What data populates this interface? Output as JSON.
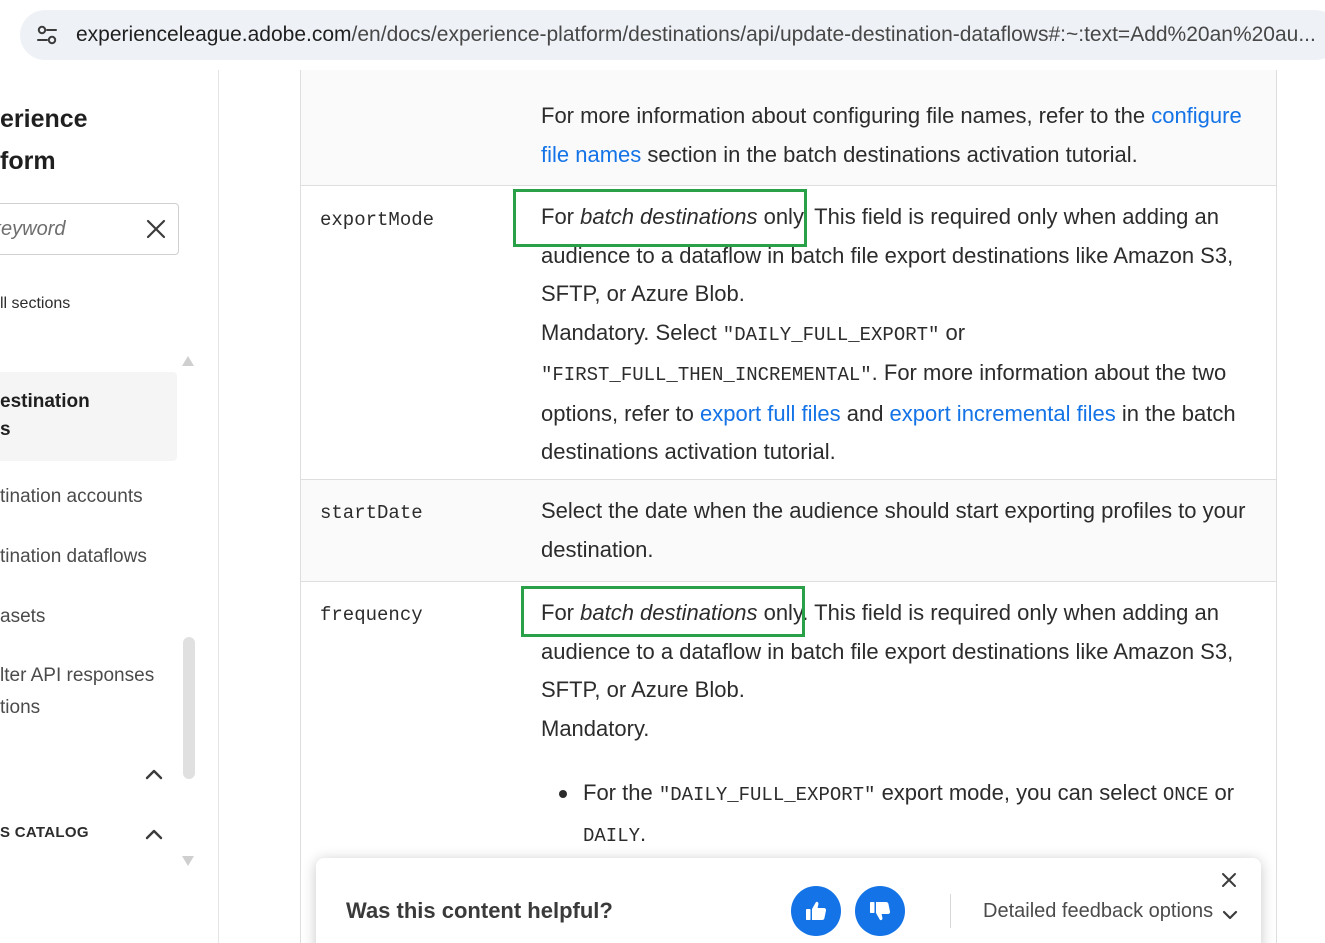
{
  "browser": {
    "url_domain": "experienceleague.adobe.com",
    "url_path": "/en/docs/experience-platform/destinations/api/update-destination-dataflows#:~:text=Add%20an%20au..."
  },
  "sidebar": {
    "title_line1": "erience",
    "title_line2": "form",
    "search_placeholder": "keyword",
    "all_sections": "ll sections",
    "active_item_line1": "estination",
    "active_item_line2": "s",
    "items": [
      "tination accounts",
      "tination dataflows",
      "asets",
      "lter API responses",
      "tions"
    ],
    "catalog_label": "S CATALOG"
  },
  "table": {
    "row0": {
      "desc_text1": "For more information about configuring file names, refer to the ",
      "desc_link": "configure file names",
      "desc_text2": " section in the batch destinations activation tutorial."
    },
    "row1": {
      "param": "exportMode",
      "for": "For ",
      "batch": "batch destinations",
      "only": " only.",
      "text1": " This field is required only when adding an audience to a dataflow in batch file export destinations like Amazon S3, SFTP, or Azure Blob.",
      "mandatory": "Mandatory. Select ",
      "code1": "\"DAILY_FULL_EXPORT\"",
      "or": " or ",
      "code2": "\"FIRST_FULL_THEN_INCREMENTAL\"",
      "text2": ". For more information about the two options, refer to ",
      "link1": "export full files",
      "and": " and ",
      "link2": "export incremental files",
      "text3": " in the batch destinations activation tutorial."
    },
    "row2": {
      "param": "startDate",
      "desc": "Select the date when the audience should start exporting profiles to your destination."
    },
    "row3": {
      "param": "frequency",
      "for": "For ",
      "batch": "batch destinations",
      "only": " only.",
      "text1": " This field is required only when adding an audience to a dataflow in batch file export destinations like Amazon S3, SFTP, or Azure Blob.",
      "mandatory": "Mandatory.",
      "bullet_text1": "For the ",
      "bullet_code1": "\"DAILY_FULL_EXPORT\"",
      "bullet_text2": " export mode, you can select ",
      "bullet_code2": "ONCE",
      "bullet_text3": " or ",
      "bullet_code3": "DAILY",
      "bullet_text4": "."
    }
  },
  "feedback": {
    "question": "Was this content helpful?",
    "detailed": "Detailed feedback options"
  },
  "colors": {
    "link": "#1473e6",
    "highlight_box": "#2aa148",
    "feedback_button": "#1473e6"
  }
}
